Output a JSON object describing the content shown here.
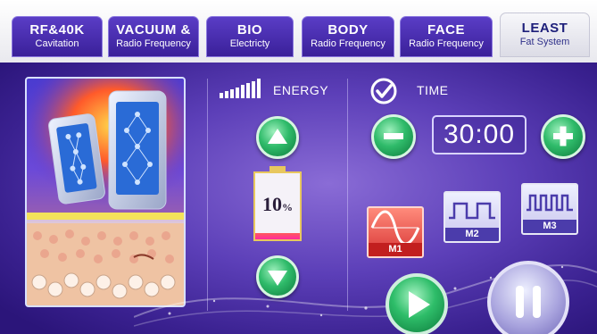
{
  "tabs": [
    {
      "title": "RF&40K",
      "subtitle": "Cavitation"
    },
    {
      "title": "VACUUM &",
      "subtitle": "Radio Frequency"
    },
    {
      "title": "BIO",
      "subtitle": "Electricty"
    },
    {
      "title": "BODY",
      "subtitle": "Radio Frequency"
    },
    {
      "title": "FACE",
      "subtitle": "Radio Frequency"
    },
    {
      "title": "LEAST",
      "subtitle": "Fat System"
    }
  ],
  "active_tab": 5,
  "energy": {
    "label": "ENERGY",
    "percent_value": "10",
    "percent_unit": "%",
    "level": 0.1
  },
  "time": {
    "label": "TIME",
    "value": "30:00"
  },
  "modes": [
    {
      "label": "M1",
      "active": true
    },
    {
      "label": "M2",
      "active": false
    },
    {
      "label": "M3",
      "active": false
    }
  ],
  "colors": {
    "accent_green": "#2fbb6a",
    "background_purple": "#5c3fb8",
    "battery_red": "#ff2a6a"
  }
}
